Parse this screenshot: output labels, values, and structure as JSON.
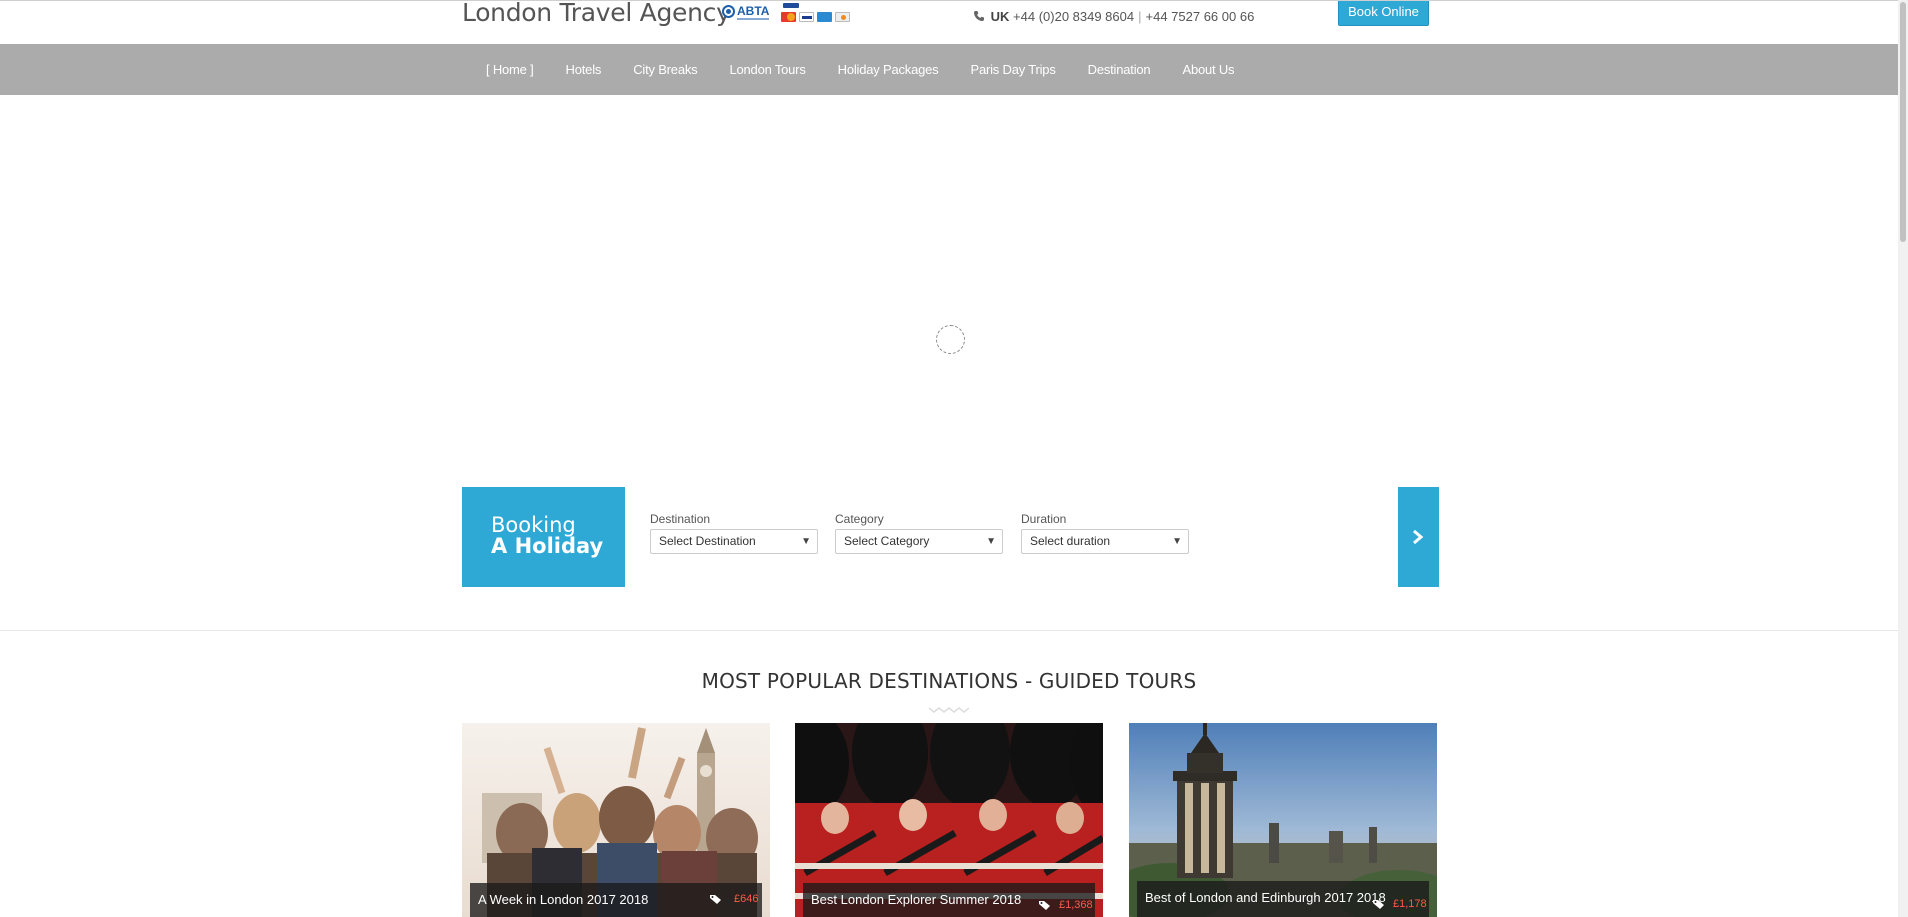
{
  "header": {
    "brand": "London Travel Agency",
    "abta": "ABTA",
    "phone_prefix": "UK",
    "phone1": "+44 (0)20 8349 8604",
    "phone2": "+44 7527 66 00 66",
    "book_online": "Book Online"
  },
  "nav": {
    "items": [
      "Home",
      "Hotels",
      "City Breaks",
      "London Tours",
      "Holiday Packages",
      "Paris Day Trips",
      "Destination",
      "About Us"
    ],
    "active": "Home"
  },
  "booking": {
    "title_line1": "Booking",
    "title_line2": "A Holiday",
    "destination_label": "Destination",
    "destination_value": "Select Destination",
    "category_label": "Category",
    "category_value": "Select Category",
    "duration_label": "Duration",
    "duration_value": "Select duration"
  },
  "section": {
    "title": "MOST POPULAR DESTINATIONS - GUIDED TOURS"
  },
  "tours": [
    {
      "title": "A Week in London 2017 2018",
      "price": "£646"
    },
    {
      "title": "Best London Explorer Summer 2018",
      "price": "£1,368"
    },
    {
      "title": "Best of London and Edinburgh 2017 2018",
      "price": "£1,178"
    }
  ],
  "colors": {
    "accent": "#2ea9d6",
    "nav_bg": "#ababab",
    "price": "#ff5a48"
  }
}
